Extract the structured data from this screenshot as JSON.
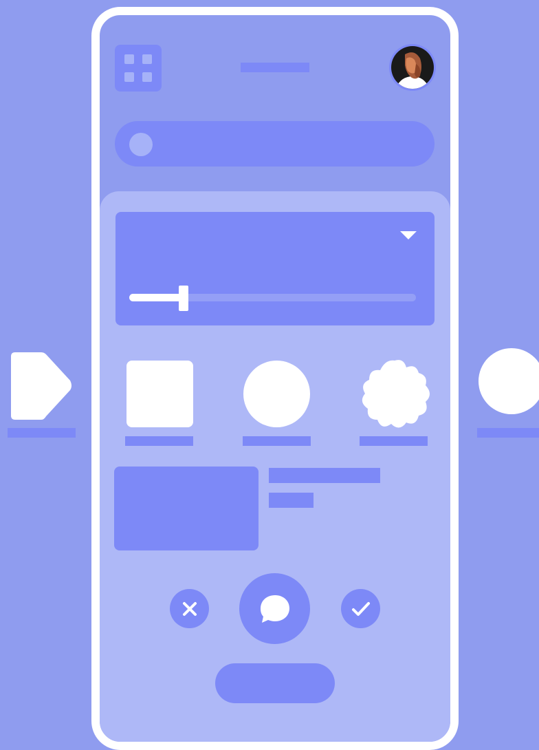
{
  "header": {
    "menu_icon": "grid-icon",
    "profile_icon": "avatar-portrait"
  },
  "search": {
    "icon": "search-dot-icon"
  },
  "controls_card": {
    "dropdown_icon": "triangle-down-icon",
    "slider_value_percent": 19
  },
  "shapes": [
    "tag-shape-icon",
    "square-shape-icon",
    "circle-shape-icon",
    "cookie-shape-icon",
    "circle-shape-icon"
  ],
  "actions": {
    "dismiss_icon": "close-icon",
    "chat_icon": "chat-bubble-icon",
    "confirm_icon": "check-icon"
  },
  "colors": {
    "background": "#8f9cef",
    "surface": "#aeb8f7",
    "accent": "#7d89f7",
    "foreground": "#ffffff"
  }
}
